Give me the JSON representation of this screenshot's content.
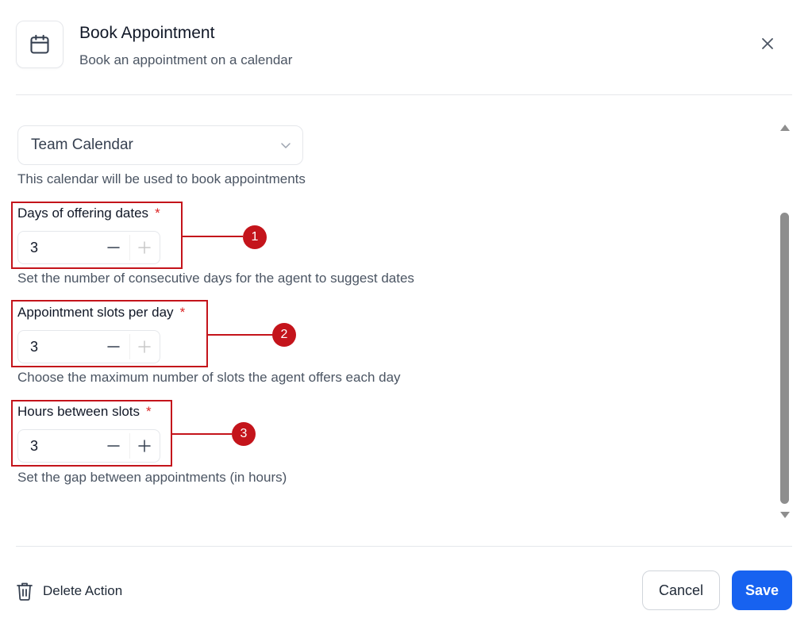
{
  "header": {
    "title": "Book Appointment",
    "subtitle": "Book an appointment on a calendar",
    "icon": "calendar-icon"
  },
  "calendar_select": {
    "value": "Team Calendar",
    "help": "This calendar will be used to book appointments"
  },
  "fields": [
    {
      "label": "Days of offering dates",
      "required_mark": "*",
      "value": "3",
      "help": "Set the number of consecutive days for the agent to suggest dates",
      "annotation": "1"
    },
    {
      "label": "Appointment slots per day",
      "required_mark": "*",
      "value": "3",
      "help": "Choose the maximum number of slots the agent offers each day",
      "annotation": "2"
    },
    {
      "label": "Hours between slots",
      "required_mark": "*",
      "value": "3",
      "help": "Set the gap between appointments (in hours)",
      "annotation": "3"
    }
  ],
  "footer": {
    "delete_label": "Delete Action",
    "cancel_label": "Cancel",
    "save_label": "Save"
  },
  "colors": {
    "accent": "#1762f0",
    "annotation": "#c4141b",
    "required": "#dc2626"
  }
}
